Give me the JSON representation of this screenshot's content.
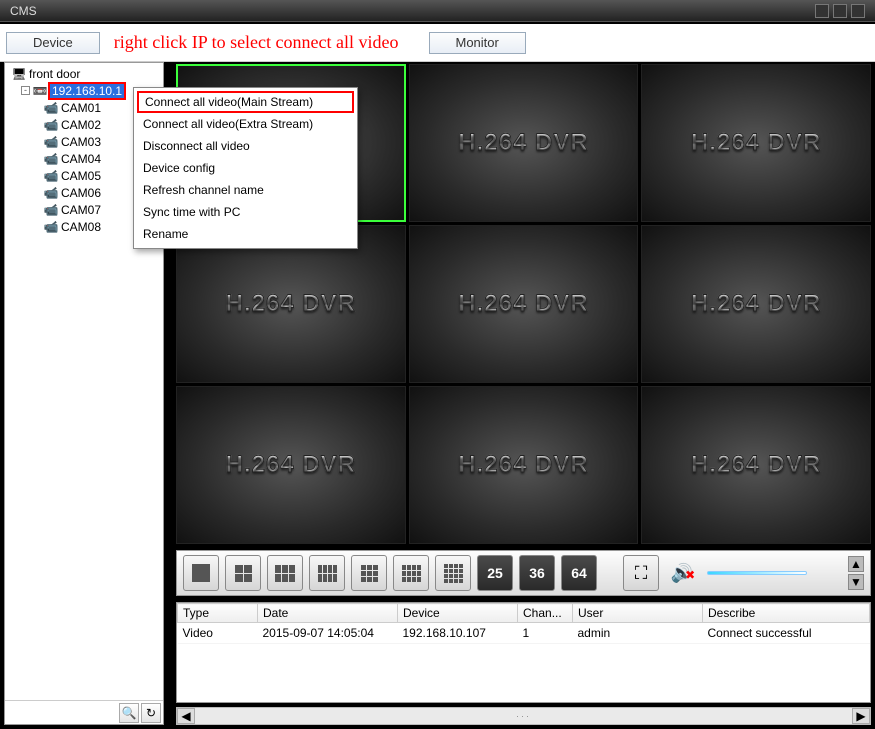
{
  "window": {
    "title": "CMS"
  },
  "tabs": {
    "device": "Device",
    "monitor": "Monitor"
  },
  "annotation": "right click IP to select connect all video",
  "tree": {
    "root": "front door",
    "ip": "192.168.10.1",
    "cams": [
      "CAM01",
      "CAM02",
      "CAM03",
      "CAM04",
      "CAM05",
      "CAM06",
      "CAM07",
      "CAM08"
    ]
  },
  "context_menu": {
    "items": [
      "Connect all video(Main Stream)",
      "Connect all video(Extra Stream)",
      "Disconnect all video",
      "Device config",
      "Refresh channel name",
      "Sync time with PC",
      "Rename"
    ]
  },
  "cell_text": "H.264 DVR",
  "layout_numbers": {
    "n25": "25",
    "n36": "36",
    "n64": "64"
  },
  "log": {
    "headers": {
      "type": "Type",
      "date": "Date",
      "device": "Device",
      "chan": "Chan...",
      "user": "User",
      "describe": "Describe"
    },
    "rows": [
      {
        "type": "Video",
        "date": "2015-09-07 14:05:04",
        "device": "192.168.10.107",
        "chan": "1",
        "user": "admin",
        "describe": "Connect successful"
      }
    ]
  }
}
